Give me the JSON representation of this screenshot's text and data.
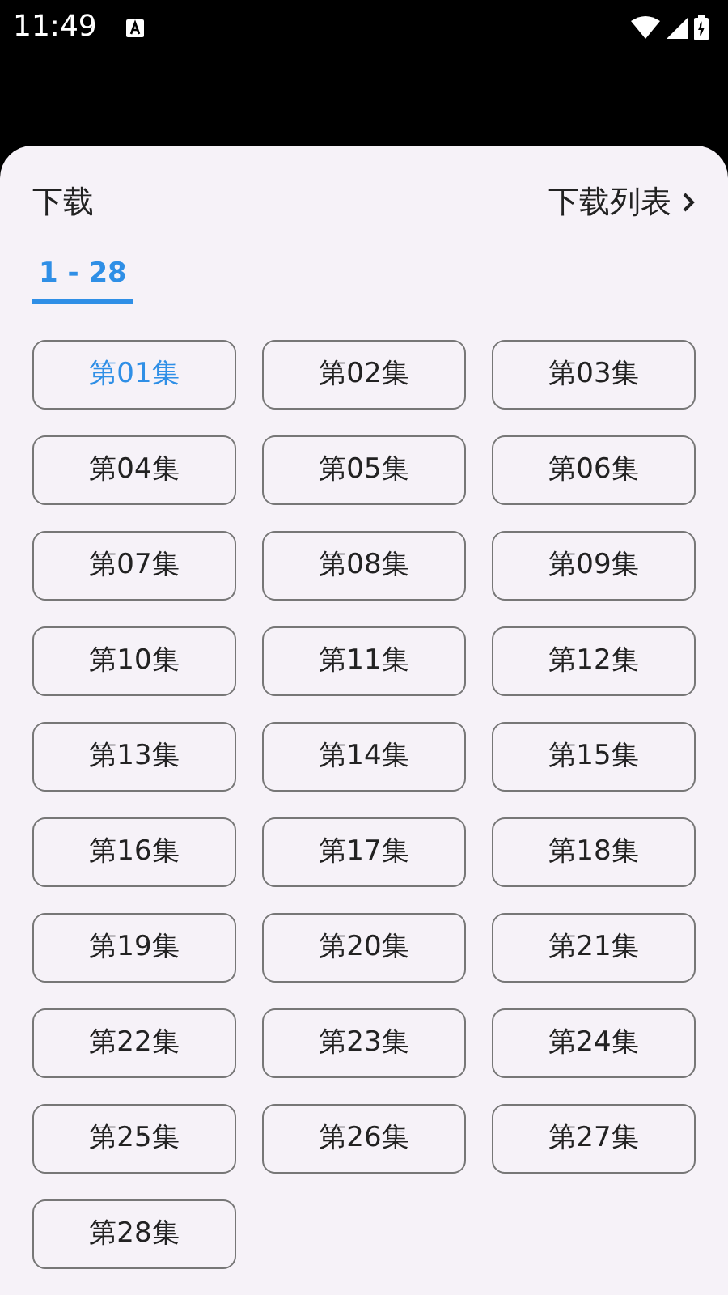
{
  "status_bar": {
    "time": "11:49"
  },
  "sheet": {
    "title": "下载",
    "list_link": "下载列表"
  },
  "tabs": [
    {
      "label": "1 - 28",
      "selected": true
    }
  ],
  "episodes": [
    {
      "label": "第01集",
      "selected": true
    },
    {
      "label": "第02集",
      "selected": false
    },
    {
      "label": "第03集",
      "selected": false
    },
    {
      "label": "第04集",
      "selected": false
    },
    {
      "label": "第05集",
      "selected": false
    },
    {
      "label": "第06集",
      "selected": false
    },
    {
      "label": "第07集",
      "selected": false
    },
    {
      "label": "第08集",
      "selected": false
    },
    {
      "label": "第09集",
      "selected": false
    },
    {
      "label": "第10集",
      "selected": false
    },
    {
      "label": "第11集",
      "selected": false
    },
    {
      "label": "第12集",
      "selected": false
    },
    {
      "label": "第13集",
      "selected": false
    },
    {
      "label": "第14集",
      "selected": false
    },
    {
      "label": "第15集",
      "selected": false
    },
    {
      "label": "第16集",
      "selected": false
    },
    {
      "label": "第17集",
      "selected": false
    },
    {
      "label": "第18集",
      "selected": false
    },
    {
      "label": "第19集",
      "selected": false
    },
    {
      "label": "第20集",
      "selected": false
    },
    {
      "label": "第21集",
      "selected": false
    },
    {
      "label": "第22集",
      "selected": false
    },
    {
      "label": "第23集",
      "selected": false
    },
    {
      "label": "第24集",
      "selected": false
    },
    {
      "label": "第25集",
      "selected": false
    },
    {
      "label": "第26集",
      "selected": false
    },
    {
      "label": "第27集",
      "selected": false
    },
    {
      "label": "第28集",
      "selected": false
    }
  ]
}
